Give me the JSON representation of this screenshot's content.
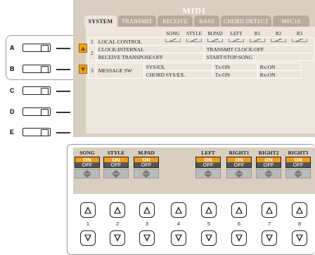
{
  "screen": {
    "title": "MIDI",
    "tabs": [
      "SYSTEM",
      "TRANSMIT",
      "RECEIVE",
      "BASS",
      "CHORD DETECT",
      "MFC10"
    ],
    "active_tab": "SYSTEM"
  },
  "left_buttons": [
    "A",
    "B",
    "C",
    "D",
    "E"
  ],
  "columns": [
    "SONG",
    "STYLE",
    "M.PAD",
    "LEFT",
    "R1",
    "R2",
    "R3"
  ],
  "rows": {
    "r1": {
      "num": "1",
      "label": "LOCAL CONTROL"
    },
    "r2a": {
      "num": "2",
      "left": "CLOCK:INTERNAL",
      "right": "TRANSMIT CLOCK:OFF"
    },
    "r2b": {
      "left": "RECEIVE TRANSPOSE:OFF",
      "right": "START/STOP:SONG"
    },
    "r3a": {
      "num": "3",
      "label": "MESSAGE SW",
      "name": "SYS/EX.",
      "tx": "Tx:ON",
      "rx": "Rx:ON"
    },
    "r3b": {
      "name": "CHORD SYS/EX.",
      "tx": "Tx:ON",
      "rx": "Rx:ON"
    }
  },
  "switches": [
    {
      "name": "SONG",
      "on": "ON",
      "off": "OFF"
    },
    {
      "name": "STYLE",
      "on": "ON",
      "off": "OFF"
    },
    {
      "name": "M.PAD",
      "on": "ON",
      "off": "OFF"
    },
    {
      "name": "",
      "on": "",
      "off": ""
    },
    {
      "name": "LEFT",
      "on": "ON",
      "off": "OFF"
    },
    {
      "name": "RIGHT1",
      "on": "ON",
      "off": "OFF"
    },
    {
      "name": "RIGHT2",
      "on": "ON",
      "off": "OFF"
    },
    {
      "name": "RIGHT3",
      "on": "ON",
      "off": "OFF"
    }
  ],
  "bottom_buttons": [
    "1",
    "2",
    "3",
    "4",
    "5",
    "6",
    "7",
    "8"
  ],
  "colors": {
    "lcd_bg": "#d8cfc0",
    "tab_body": "#ece6dc",
    "on_orange": "#f39a1c",
    "arrow": "#f0a500"
  }
}
